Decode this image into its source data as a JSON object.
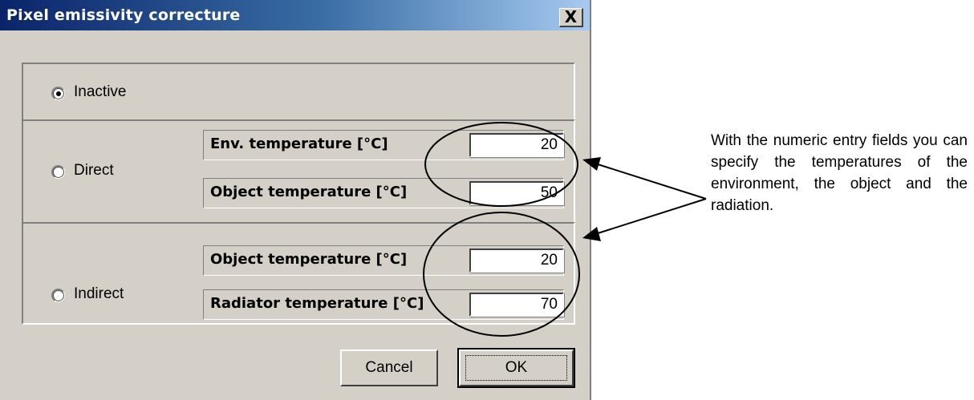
{
  "dialog": {
    "title": "Pixel emissivity correcture",
    "close_label": "X"
  },
  "modes": {
    "inactive": {
      "label": "Inactive",
      "checked": true
    },
    "direct": {
      "label": "Direct",
      "checked": false,
      "fields": [
        {
          "label": "Env. temperature  [°C]",
          "value": "20"
        },
        {
          "label": "Object temperature  [°C]",
          "value": "50"
        }
      ]
    },
    "indirect": {
      "label": "Indirect",
      "checked": false,
      "fields": [
        {
          "label": "Object temperature  [°C]",
          "value": "20"
        },
        {
          "label": "Radiator temperature  [°C]",
          "value": "70"
        }
      ]
    }
  },
  "buttons": {
    "cancel": "Cancel",
    "ok": "OK"
  },
  "annotation": {
    "text": "With the numeric entry fields you can specify the temperatures of the environment, the object and the radiation."
  }
}
